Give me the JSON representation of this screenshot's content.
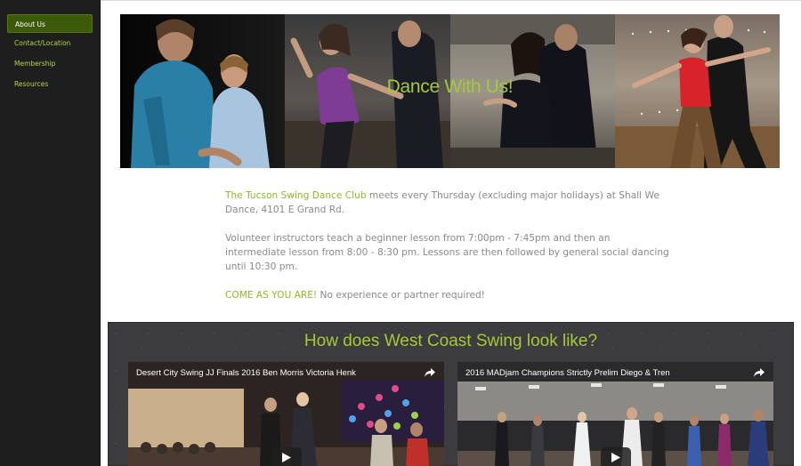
{
  "sidebar": {
    "items": [
      {
        "label": "About Us",
        "active": true
      },
      {
        "label": "Contact/Location",
        "active": false
      },
      {
        "label": "Membership",
        "active": false
      },
      {
        "label": "Resources",
        "active": false
      }
    ]
  },
  "hero": {
    "title": "Dance With Us!"
  },
  "intro": {
    "club_name": "The Tucson Swing Dance Club",
    "p1_rest": " meets every Thursday (excluding major holidays) at Shall We Dance, 4101 E Grand Rd.",
    "p2": "Volunteer instructors teach a beginner lesson from 7:00pm - 7:45pm and then an intermediate lesson from 8:00 - 8:30 pm. Lessons are then followed by general social dancing until 10:30 pm.",
    "come_as_you_are": "COME AS YOU ARE!",
    "p3_rest": " No experience or partner required!"
  },
  "videos_section": {
    "heading": "How does West Coast Swing look like?",
    "videos": [
      {
        "title": "Desert City Swing JJ Finals 2016 Ben Morris Victoria Henk"
      },
      {
        "title": "2016 MADjam Champions Strictly Prelim Diego & Tren"
      }
    ]
  },
  "colors": {
    "accent_green": "#8cba2c",
    "sidebar_bg": "#1e1e1e",
    "active_nav_bg": "#3d5a0a",
    "section_bg": "#3c3c3e"
  }
}
